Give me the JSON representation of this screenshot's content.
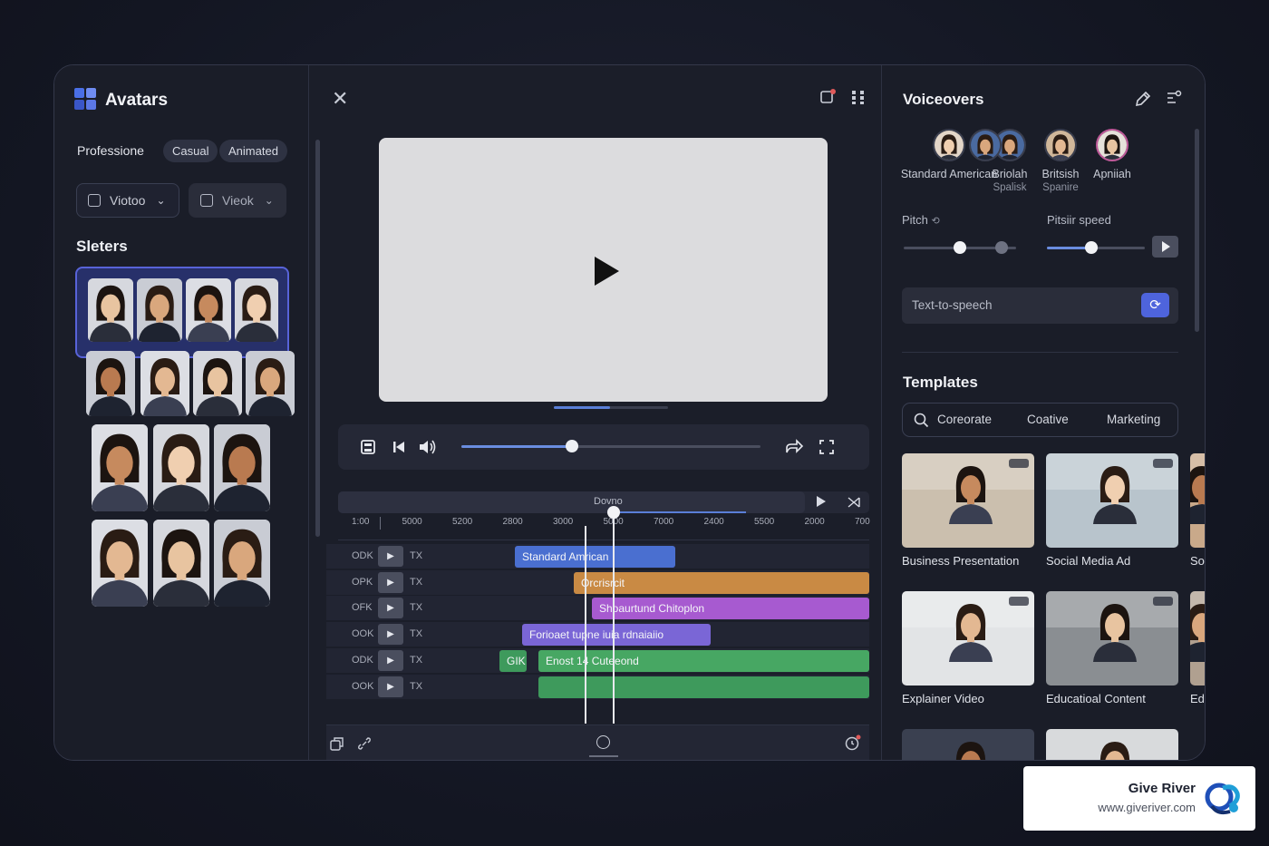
{
  "left_panel": {
    "title": "Avatars",
    "category_label": "Professione",
    "chips": [
      "Casual",
      "Animated"
    ],
    "dropdowns": [
      {
        "label": "Viotoo"
      },
      {
        "label": "Vieok"
      }
    ],
    "section_title": "Sleters"
  },
  "timeline": {
    "label": "Dovno",
    "ruler": [
      "1:00",
      "5000",
      "5200",
      "2800",
      "3000",
      "5000",
      "7000",
      "2400",
      "5500",
      "2000",
      "700"
    ],
    "tracks": [
      {
        "id": "ODK",
        "kind": "TX",
        "clips": [
          {
            "text": "Standard Amrican",
            "color": "#4a6fd0"
          }
        ]
      },
      {
        "id": "OPK",
        "kind": "TX",
        "clips": [
          {
            "text": "Orcrisrcit",
            "color": "#c98a44"
          }
        ]
      },
      {
        "id": "OFK",
        "kind": "TX",
        "clips": [
          {
            "text": "Shoaurtund Chitoplon",
            "color": "#a75ad0"
          }
        ]
      },
      {
        "id": "OOK",
        "kind": "TX",
        "clips": [
          {
            "text": "Forioaet tupne iuia rdnaiaiio",
            "color": "#7a66d6"
          }
        ]
      },
      {
        "id": "ODK",
        "kind": "TX",
        "clips": [
          {
            "text": "GIK",
            "color": "#3e9a5c"
          },
          {
            "text": "Enost 14 Cuteeond",
            "color": "#47a763"
          }
        ]
      },
      {
        "id": "OOK",
        "kind": "TX",
        "clips": [
          {
            "text": "",
            "color": "#3e9a5c"
          }
        ]
      }
    ]
  },
  "voiceovers": {
    "title": "Voiceovers",
    "voices": [
      {
        "name": "Standard American",
        "sub": ""
      },
      {
        "name": "Briolah",
        "sub": "Spalisk"
      },
      {
        "name": "Britsish",
        "sub": "Spanire"
      },
      {
        "name": "Apniiah",
        "sub": ""
      }
    ],
    "pitch_label": "Pitch",
    "speed_label": "Pitsiir speed",
    "tts_placeholder": "Text-to-speech",
    "pitch_value": 0.5,
    "speed_value": 0.45
  },
  "templates": {
    "title": "Templates",
    "filters": [
      "Coreorate",
      "Coative",
      "Marketing"
    ],
    "cards": [
      {
        "caption": "Business Presentation"
      },
      {
        "caption": "Social Media Ad"
      },
      {
        "caption": "So"
      },
      {
        "caption": "Explainer Video"
      },
      {
        "caption": "Educatioal Content"
      },
      {
        "caption": "Ed"
      }
    ]
  },
  "watermark": {
    "brand": "Give River",
    "url": "www.giveriver.com"
  },
  "colors": {
    "accent": "#4e64dc",
    "selection": "#5863d8",
    "background": "#1a1d28"
  },
  "icons": [
    "close-icon",
    "notification-icon",
    "grid-icon",
    "play-icon",
    "skip-back-icon",
    "volume-icon",
    "share-icon",
    "fullscreen-icon",
    "pen-icon",
    "settings-icon",
    "refresh-icon",
    "search-icon"
  ]
}
